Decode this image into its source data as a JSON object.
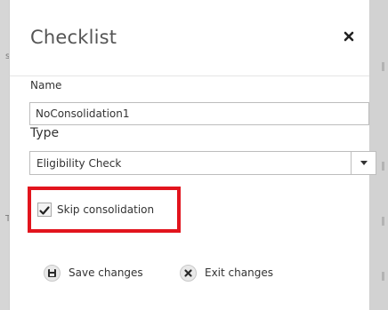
{
  "background": {
    "left_glyph_top": "s",
    "left_glyph_bottom": "T"
  },
  "dialog": {
    "title": "Checklist",
    "close_icon": "close-icon",
    "fields": {
      "name_label": "Name",
      "name_value": "NoConsolidation1",
      "type_label": "Type",
      "type_value": "Eligibility Check",
      "type_icon": "caret-down-icon"
    },
    "skip_consolidation": {
      "label": "Skip consolidation",
      "checked": true
    },
    "actions": {
      "save_label": "Save changes",
      "save_icon": "floppy-disk-icon",
      "exit_label": "Exit changes",
      "exit_icon": "close-circle-icon"
    }
  },
  "colors": {
    "highlight": "#e2141d",
    "dialog_background": "#ffffff",
    "overlay": "#d6d6d6"
  }
}
